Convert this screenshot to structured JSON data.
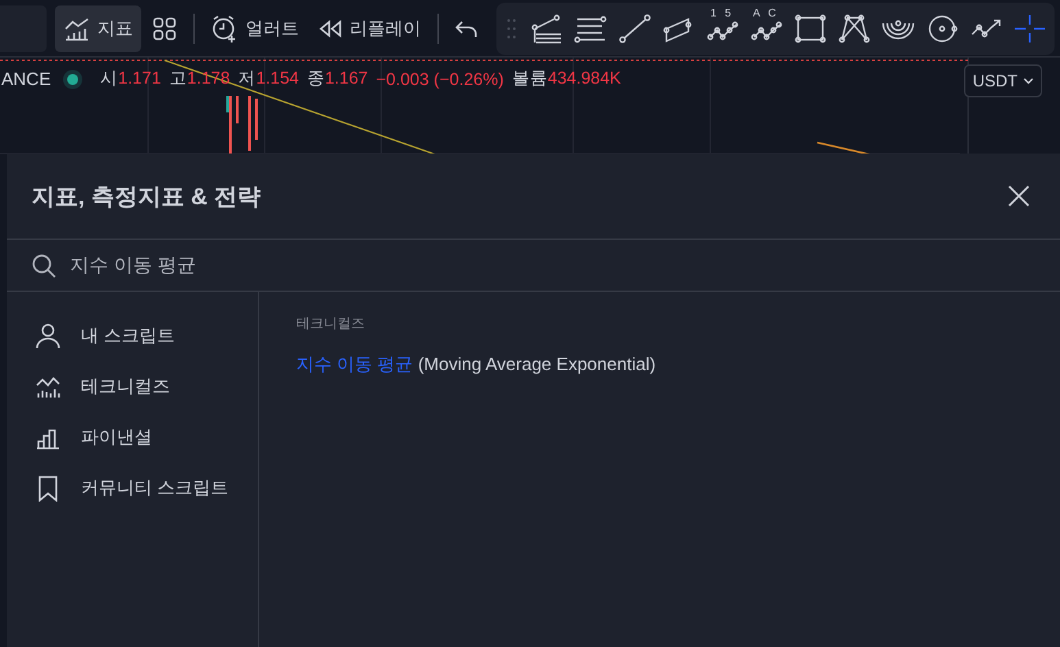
{
  "toolbar": {
    "items": [
      {
        "kind": "indicators",
        "label": "지표",
        "selected": true
      },
      {
        "kind": "layouts",
        "selected": false
      },
      {
        "kind": "alert",
        "label": "얼러트",
        "selected": false
      },
      {
        "kind": "replay",
        "label": "리플레이",
        "selected": false
      },
      {
        "kind": "undo",
        "selected": false
      }
    ],
    "drawing_tools": [
      {
        "kind": "pitchfork",
        "selected": false
      },
      {
        "kind": "lines",
        "selected": false
      },
      {
        "kind": "trendline",
        "selected": false
      },
      {
        "kind": "channel",
        "selected": false
      },
      {
        "kind": "wave",
        "label": "1 5",
        "selected": false
      },
      {
        "kind": "wave",
        "label": "A C",
        "selected": false
      },
      {
        "kind": "rectangle",
        "selected": false
      },
      {
        "kind": "pattern",
        "selected": false
      },
      {
        "kind": "arcs",
        "selected": false
      },
      {
        "kind": "circle",
        "selected": false
      },
      {
        "kind": "path",
        "selected": false
      },
      {
        "kind": "crosshair",
        "selected": true
      }
    ]
  },
  "legend": {
    "symbol": "ANCE",
    "values": [
      {
        "label": "시",
        "value": "1.171"
      },
      {
        "label": "고",
        "value": "1.178"
      },
      {
        "label": "저",
        "value": "1.154"
      },
      {
        "label": "종",
        "value": "1.167"
      }
    ],
    "change": "−0.003 (−0.26%)",
    "volume_label": "볼륨",
    "volume": "434.984K"
  },
  "currency": "USDT",
  "dialog": {
    "title": "지표, 측정지표 & 전략",
    "search": {
      "value": "지수 이동 평균"
    },
    "sidebar": [
      {
        "kind": "user",
        "label": "내 스크립트",
        "selected": false
      },
      {
        "kind": "technicals",
        "label": "테크니컬즈",
        "selected": false
      },
      {
        "kind": "financials",
        "label": "파이낸셜",
        "selected": false
      },
      {
        "kind": "community",
        "label": "커뮤니티 스크립트",
        "selected": false
      }
    ],
    "section": "테크니컬즈",
    "results": [
      {
        "match": "지수 이동 평균",
        "rest": " (Moving Average Exponential)"
      }
    ]
  }
}
